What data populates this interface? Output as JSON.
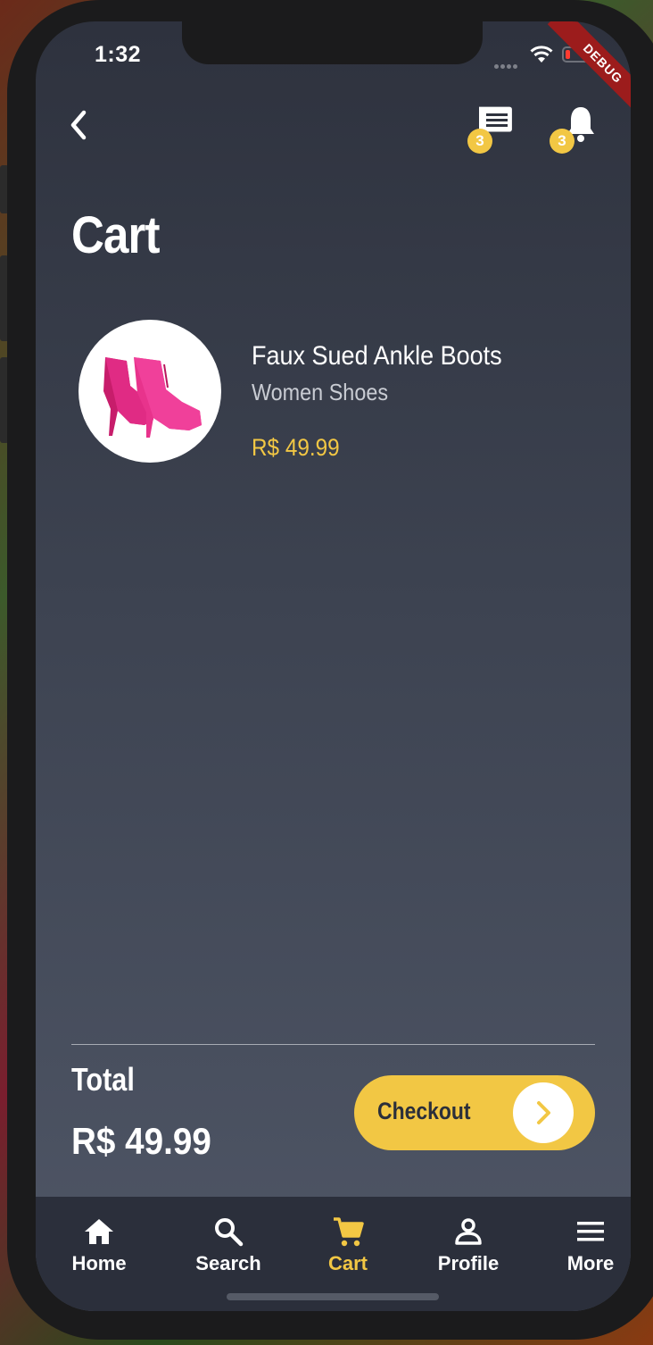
{
  "status_bar": {
    "time": "1:32",
    "debug_banner": "DEBUG"
  },
  "header": {
    "back_icon": "chevron-left-icon",
    "messages": {
      "icon": "message-icon",
      "badge": "3"
    },
    "notifications": {
      "icon": "bell-icon",
      "badge": "3"
    }
  },
  "page": {
    "title": "Cart"
  },
  "cart": {
    "items": [
      {
        "name": "Faux Sued Ankle Boots",
        "category": "Women Shoes",
        "price": "R$ 49.99",
        "image": "pink-ankle-boots"
      }
    ],
    "total_label": "Total",
    "total_value": "R$ 49.99",
    "checkout_label": "Checkout"
  },
  "tabbar": {
    "items": [
      {
        "label": "Home",
        "icon": "home-icon"
      },
      {
        "label": "Search",
        "icon": "search-icon"
      },
      {
        "label": "Cart",
        "icon": "cart-icon",
        "active": true
      },
      {
        "label": "Profile",
        "icon": "person-icon"
      },
      {
        "label": "More",
        "icon": "menu-icon"
      }
    ]
  },
  "colors": {
    "accent": "#f2c744",
    "background_top": "#2e323e",
    "background_bottom": "#4f5666",
    "tabbar": "#2b2f3b"
  }
}
